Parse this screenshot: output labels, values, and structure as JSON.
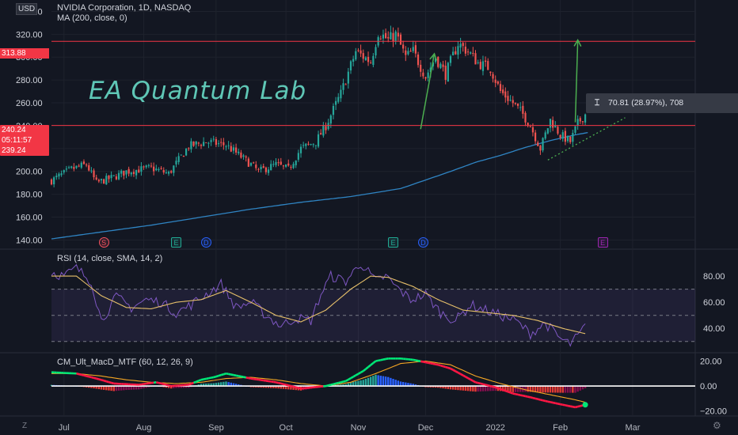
{
  "currency_badge": "USD",
  "symbol_legend": "NVIDIA Corporation, 1D, NASDAQ",
  "ma_legend": "MA (200, close, 0)",
  "watermark": "EA Quantum Lab",
  "measure_tool": {
    "icon": "measure-range-icon",
    "text": "70.81 (28.97%), 708"
  },
  "price_badges": {
    "resistance": "313.88",
    "last": "240.24",
    "countdown": "05:11:57",
    "prev": "239.24"
  },
  "events": [
    {
      "label": "S",
      "type": "split",
      "color": "#f7525f"
    },
    {
      "label": "E",
      "type": "earnings",
      "color": "#22ab94"
    },
    {
      "label": "D",
      "type": "dividend",
      "color": "#2962ff"
    },
    {
      "label": "E",
      "type": "earnings",
      "color": "#22ab94"
    },
    {
      "label": "D",
      "type": "dividend",
      "color": "#2962ff"
    },
    {
      "label": "E",
      "type": "earnings-upcoming",
      "color": "#9c27b0"
    }
  ],
  "rsi_legend": "RSI (14, close, SMA, 14, 2)",
  "macd_legend": "CM_Ult_MacD_MTF (60, 12, 26, 9)",
  "footer_left_icon": "timezone-icon",
  "footer_right_icon": "settings-icon",
  "colors": {
    "up": "#26a69a",
    "down": "#ef5350",
    "ma": "#2f84c3",
    "rsi": "#7e57c2",
    "rsi_ma": "#e7c06a",
    "level": "#f23645",
    "arrow": "#4caf50",
    "dotted": "#4caf50"
  },
  "chart_data": [
    {
      "type": "candlestick",
      "title": "NVIDIA Corporation, 1D, NASDAQ",
      "x_ticks": [
        "Jul",
        "Aug",
        "Sep",
        "Oct",
        "Nov",
        "Dec",
        "2022",
        "Feb",
        "Mar"
      ],
      "y_ticks": [
        "140.00",
        "160.00",
        "180.00",
        "200.00",
        "220.00",
        "240.00",
        "260.00",
        "280.00",
        "300.00",
        "320.00",
        "340.00"
      ],
      "ylim": [
        132,
        350
      ],
      "grid": true,
      "levels": [
        313.88,
        240.24
      ],
      "ma_series": {
        "name": "MA (200, close, 0)",
        "x": [
          0,
          20,
          40,
          60,
          80,
          100,
          120,
          140,
          160,
          170,
          180,
          190,
          200,
          210,
          215
        ],
        "values": [
          141,
          147,
          153,
          160,
          167,
          173,
          178,
          185,
          200,
          208,
          214,
          221,
          227,
          232,
          234
        ]
      },
      "price_path": {
        "x": [
          0,
          8,
          14,
          18,
          25,
          30,
          40,
          47,
          55,
          62,
          70,
          80,
          83,
          90,
          95,
          100,
          106,
          110,
          116,
          122,
          128,
          131,
          135,
          138,
          142,
          145,
          150,
          154,
          158,
          163,
          167,
          171,
          176,
          180,
          185,
          189,
          192,
          196,
          200,
          204,
          208,
          211,
          214
        ],
        "values": [
          192,
          202,
          206,
          190,
          195,
          200,
          203,
          198,
          222,
          226,
          223,
          206,
          200,
          206,
          202,
          220,
          226,
          240,
          268,
          305,
          296,
          322,
          315,
          320,
          300,
          305,
          283,
          300,
          285,
          312,
          305,
          295,
          290,
          270,
          260,
          250,
          240,
          220,
          245,
          232,
          226,
          242,
          250
        ]
      }
    },
    {
      "type": "line",
      "title": "RSI (14, close, SMA, 14, 2)",
      "y_ticks": [
        "40.00",
        "60.00",
        "80.00"
      ],
      "ylim": [
        22,
        100
      ],
      "bands": [
        70,
        50,
        30
      ],
      "series": [
        {
          "name": "RSI",
          "x": [
            0,
            5,
            10,
            16,
            20,
            26,
            32,
            38,
            44,
            50,
            56,
            62,
            68,
            74,
            80,
            86,
            92,
            98,
            104,
            108,
            112,
            118,
            124,
            130,
            134,
            138,
            144,
            150,
            156,
            162,
            168,
            174,
            180,
            186,
            192,
            198,
            204,
            208,
            212,
            214
          ],
          "values": [
            83,
            80,
            86,
            76,
            46,
            64,
            56,
            62,
            60,
            52,
            58,
            66,
            74,
            56,
            60,
            50,
            42,
            48,
            46,
            66,
            80,
            76,
            90,
            76,
            80,
            72,
            62,
            66,
            52,
            46,
            58,
            54,
            50,
            46,
            36,
            44,
            32,
            28,
            36,
            42
          ]
        },
        {
          "name": "SMA",
          "x": [
            0,
            10,
            20,
            30,
            40,
            50,
            60,
            70,
            80,
            90,
            100,
            110,
            120,
            128,
            135,
            145,
            155,
            165,
            175,
            185,
            195,
            205,
            214
          ],
          "values": [
            80,
            80,
            65,
            56,
            55,
            60,
            62,
            69,
            60,
            50,
            45,
            54,
            70,
            80,
            79,
            72,
            62,
            54,
            52,
            50,
            46,
            40,
            36
          ]
        }
      ]
    },
    {
      "type": "bar",
      "title": "CM_Ult_MacD_MTF (60, 12, 26, 9)",
      "y_ticks": [
        "20.00",
        "0.00",
        "−20.00"
      ],
      "ylim": [
        -24,
        26
      ],
      "macd_line": {
        "x": [
          0,
          10,
          18,
          25,
          35,
          42,
          48,
          55,
          60,
          65,
          70,
          80,
          90,
          100,
          110,
          118,
          125,
          130,
          135,
          140,
          145,
          150,
          155,
          160,
          170,
          178,
          185,
          192,
          198,
          205,
          210,
          214
        ],
        "values": [
          11,
          10,
          6,
          2,
          1,
          3,
          0,
          1,
          5,
          7,
          10,
          6,
          3,
          -2,
          0,
          4,
          12,
          20,
          22,
          22,
          21,
          19,
          17,
          14,
          3,
          -1,
          -6,
          -9,
          -12,
          -15,
          -17,
          -15
        ]
      },
      "signal_line": {
        "x": [
          0,
          10,
          20,
          30,
          40,
          50,
          60,
          70,
          80,
          90,
          100,
          110,
          120,
          130,
          140,
          150,
          160,
          170,
          180,
          190,
          200,
          210,
          214
        ],
        "values": [
          10,
          10,
          8,
          5,
          3,
          2,
          3,
          6,
          7,
          5,
          2,
          0,
          3,
          10,
          18,
          20,
          17,
          8,
          2,
          -3,
          -7,
          -11,
          -13
        ]
      }
    }
  ]
}
